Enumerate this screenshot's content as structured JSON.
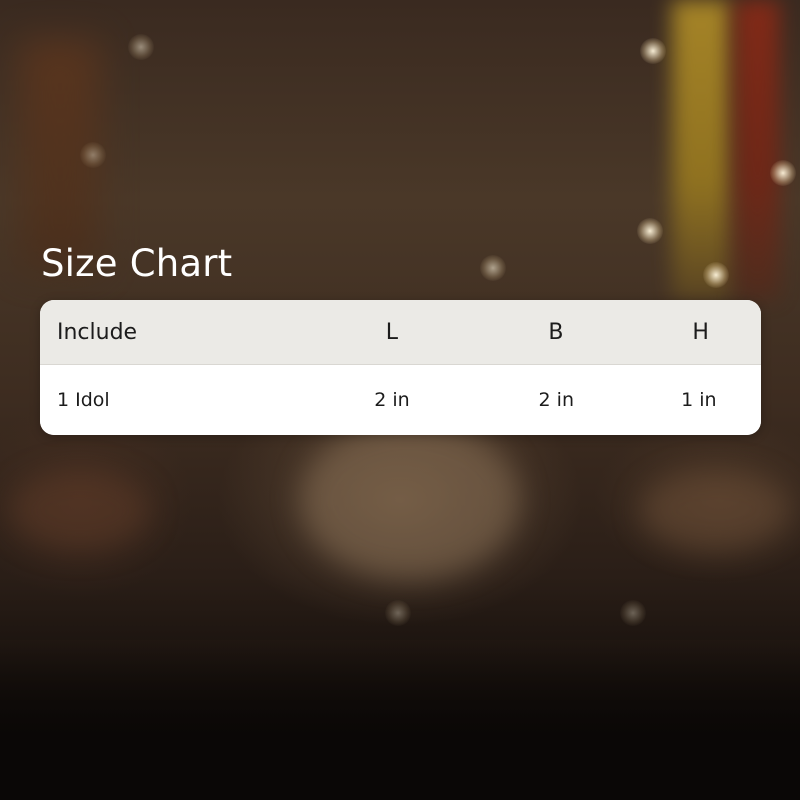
{
  "title": "Size Chart",
  "table": {
    "headers": [
      "Include",
      "L",
      "B",
      "H"
    ],
    "rows": [
      [
        "1 Idol",
        "2 in",
        "2 in",
        "1 in"
      ]
    ]
  },
  "colors": {
    "header_bg": "#ebeae6",
    "row_bg": "#ffffff",
    "title_text": "#ffffff",
    "cell_text": "#1c1c1c"
  }
}
